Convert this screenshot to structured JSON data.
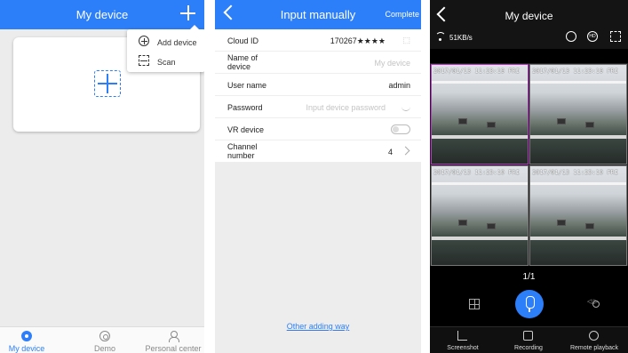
{
  "screen1": {
    "title": "My device",
    "menu": {
      "add_device": "Add device",
      "scan": "Scan"
    },
    "tabs": [
      {
        "label": "My device",
        "icon": "camera-icon",
        "active": true
      },
      {
        "label": "Demo",
        "icon": "demo-icon",
        "active": false
      },
      {
        "label": "Personal center",
        "icon": "person-icon",
        "active": false
      }
    ]
  },
  "screen2": {
    "title": "Input manually",
    "complete": "Complete",
    "fields": [
      {
        "key": "Cloud ID",
        "value": "170267★★★★",
        "type": "value",
        "tail": "scan-icon"
      },
      {
        "key": "Name of device",
        "value": "My device",
        "type": "placeholder"
      },
      {
        "key": "User name",
        "value": "admin",
        "type": "value"
      },
      {
        "key": "Password",
        "value": "Input device password",
        "type": "placeholder",
        "tail": "eye-icon"
      },
      {
        "key": "VR device",
        "value": "",
        "type": "toggle",
        "checked": false
      },
      {
        "key": "Channel number",
        "value": "4",
        "type": "value",
        "tail": "chevron-right-icon"
      }
    ],
    "other_way": "Other adding way"
  },
  "screen3": {
    "title": "My device",
    "speed": "51KB/s",
    "hd_label": "HD",
    "timestamp": "2017/01/13 11:23:19 FRI",
    "page": "1/1",
    "bottom": [
      {
        "label": "Screenshot",
        "icon": "crop-icon"
      },
      {
        "label": "Recording",
        "icon": "record-icon"
      },
      {
        "label": "Remote playback",
        "icon": "replay-icon"
      }
    ]
  },
  "colors": {
    "accent": "#2d7ff9",
    "selected_frame": "#bb33cc"
  }
}
